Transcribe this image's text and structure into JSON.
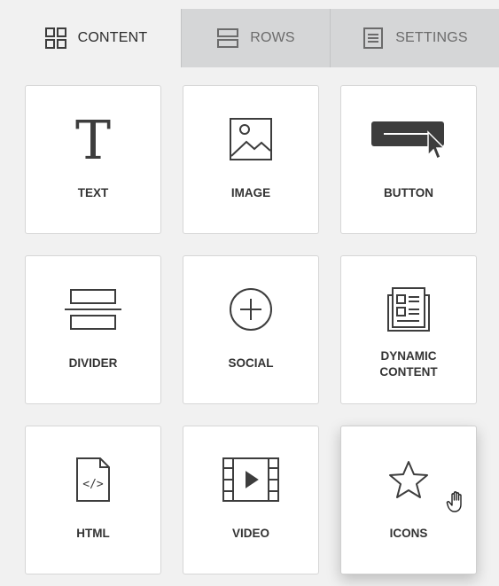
{
  "tabs": [
    {
      "label": "CONTENT",
      "icon": "grid-icon",
      "active": true
    },
    {
      "label": "ROWS",
      "icon": "rows-icon",
      "active": false
    },
    {
      "label": "SETTINGS",
      "icon": "settings-icon",
      "active": false
    }
  ],
  "blocks": [
    {
      "label": "TEXT",
      "icon": "text-icon"
    },
    {
      "label": "IMAGE",
      "icon": "image-icon"
    },
    {
      "label": "BUTTON",
      "icon": "button-icon"
    },
    {
      "label": "DIVIDER",
      "icon": "divider-icon"
    },
    {
      "label": "SOCIAL",
      "icon": "social-icon"
    },
    {
      "label": "DYNAMIC\nCONTENT",
      "icon": "dynamic-content-icon"
    },
    {
      "label": "HTML",
      "icon": "html-icon"
    },
    {
      "label": "VIDEO",
      "icon": "video-icon"
    },
    {
      "label": "ICONS",
      "icon": "star-icon",
      "hovered": true
    }
  ],
  "colors": {
    "icon": "#3d3d3d",
    "active_tab_bg": "#f1f1f1",
    "inactive_tab_bg": "#d5d6d7",
    "card_bg": "#ffffff"
  }
}
